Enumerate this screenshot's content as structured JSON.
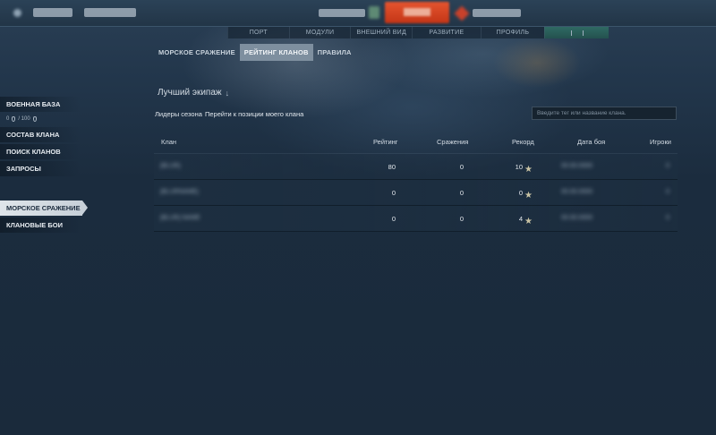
{
  "main_nav": [
    "ПОРТ",
    "МОДУЛИ",
    "ВНЕШНИЙ ВИД",
    "РАЗВИТИЕ",
    "ПРОФИЛЬ"
  ],
  "sub_tabs": [
    "МОРСКОЕ СРАЖЕНИЕ",
    "РЕЙТИНГ КЛАНОВ",
    "ПРАВИЛА"
  ],
  "sidebar": {
    "naval_base": "ВОЕННАЯ БАЗА",
    "resource_amount": "0",
    "resource_max": "/ 100",
    "clan_roster": "СОСТАВ КЛАНА",
    "clan_search": "ПОИСК КЛАНОВ",
    "requests": "ЗАПРОСЫ",
    "naval_battle": "МОРСКОЕ СРАЖЕНИЕ",
    "clan_battles": "КЛАНОВЫЕ БОИ"
  },
  "content": {
    "best_crew": "Лучший экипаж",
    "season_leaders": "Лидеры сезона",
    "goto_my_clan": "Перейти к позиции моего клана",
    "search_placeholder": "Введите тег или название клана."
  },
  "table": {
    "headers": {
      "clan": "Клан",
      "rating": "Рейтинг",
      "battles": "Сражения",
      "record": "Рекорд",
      "battle_date": "Дата боя",
      "players": "Игроки"
    },
    "rows": [
      {
        "clan": "[BLUR]",
        "rating": "80",
        "battles": "0",
        "record": "10",
        "date": "00.00.0000",
        "players": "0"
      },
      {
        "clan": "[BLURNAME]",
        "rating": "0",
        "battles": "0",
        "record": "0",
        "date": "00.00.0000",
        "players": "0"
      },
      {
        "clan": "[BLUR] NAME",
        "rating": "0",
        "battles": "0",
        "record": "4",
        "date": "00.00.0000",
        "players": "0"
      }
    ]
  }
}
